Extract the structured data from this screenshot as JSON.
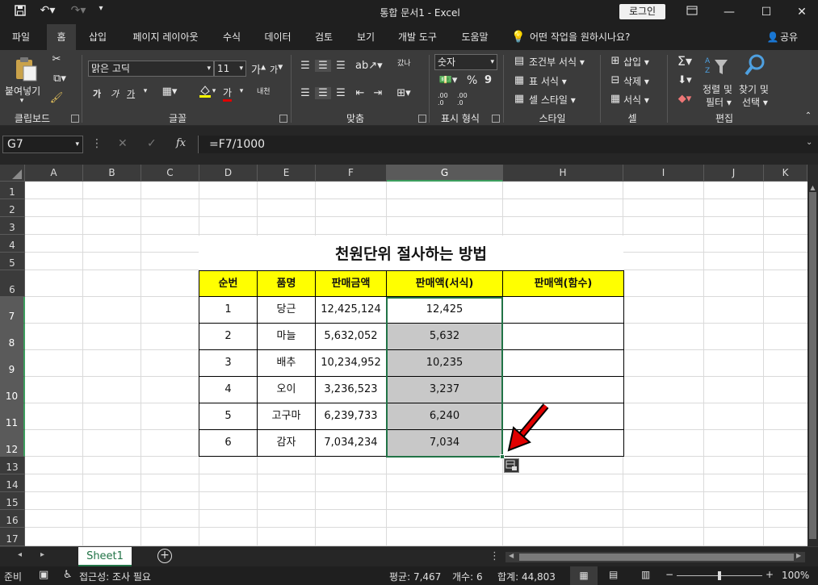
{
  "window": {
    "title": "통합 문서1  -  Excel",
    "login_label": "로그인"
  },
  "tabs": [
    "파일",
    "홈",
    "삽입",
    "페이지 레이아웃",
    "수식",
    "데이터",
    "검토",
    "보기",
    "개발 도구",
    "도움말"
  ],
  "active_tab": "홈",
  "tell_me": "어떤 작업을 원하시나요?",
  "share_label": "공유",
  "ribbon": {
    "clipboard": {
      "paste_label": "붙여넣기",
      "group_label": "클립보드"
    },
    "font": {
      "font_name": "맑은 고딕",
      "font_size": "11",
      "group_label": "글꼴",
      "inc_label": "가",
      "dec_label": "가",
      "bold": "가",
      "italic": "가",
      "underline": "가",
      "phonetic_label": "내천",
      "fontcolor_label": "가"
    },
    "alignment": {
      "group_label": "맞춤",
      "wrap_label": "갔나"
    },
    "number": {
      "format": "숫자",
      "group_label": "표시 형식",
      "percent": "%",
      "comma": "9",
      "inc_decimal": ".00\n.0",
      "dec_decimal": ".00\n.0"
    },
    "styles": {
      "conditional": "조건부 서식",
      "table": "표 서식",
      "cell_style": "셀 스타일",
      "group_label": "스타일"
    },
    "cells": {
      "insert": "삽입",
      "delete": "삭제",
      "format": "서식",
      "group_label": "셀"
    },
    "editing": {
      "sort_filter_1": "정렬 및",
      "sort_filter_2": "필터",
      "find_select_1": "찾기 및",
      "find_select_2": "선택",
      "group_label": "편집"
    }
  },
  "formula_bar": {
    "name_box": "G7",
    "formula": "=F7/1000",
    "fx_label": "fx"
  },
  "columns": [
    "A",
    "B",
    "C",
    "D",
    "E",
    "F",
    "G",
    "H",
    "I",
    "J",
    "K"
  ],
  "rows": [
    "1",
    "2",
    "3",
    "4",
    "5",
    "6",
    "7",
    "8",
    "9",
    "10",
    "11",
    "12",
    "13",
    "14",
    "15",
    "16",
    "17"
  ],
  "selected_column": "G",
  "sheet": {
    "title": "천원단위 절사하는 방법",
    "headers": [
      "순번",
      "품명",
      "판매금액",
      "판매액(서식)",
      "판매액(함수)"
    ],
    "data": [
      [
        "1",
        "당근",
        "12,425,124",
        "12,425",
        ""
      ],
      [
        "2",
        "마늘",
        "5,632,052",
        "5,632",
        ""
      ],
      [
        "3",
        "배추",
        "10,234,952",
        "10,235",
        ""
      ],
      [
        "4",
        "오이",
        "3,236,523",
        "3,237",
        ""
      ],
      [
        "5",
        "고구마",
        "6,239,733",
        "6,240",
        ""
      ],
      [
        "6",
        "감자",
        "7,034,234",
        "7,034",
        ""
      ]
    ]
  },
  "sheet_tabs": {
    "active": "Sheet1"
  },
  "status": {
    "mode": "준비",
    "accessibility": "접근성: 조사 필요",
    "average": "평균: 7,467",
    "count": "개수: 6",
    "sum": "합계: 44,803",
    "zoom": "100%"
  },
  "colors": {
    "accent": "#217346",
    "header_fill": "#ffff00",
    "selected_fill": "#c8c8c8",
    "arrow": "#e00000"
  }
}
